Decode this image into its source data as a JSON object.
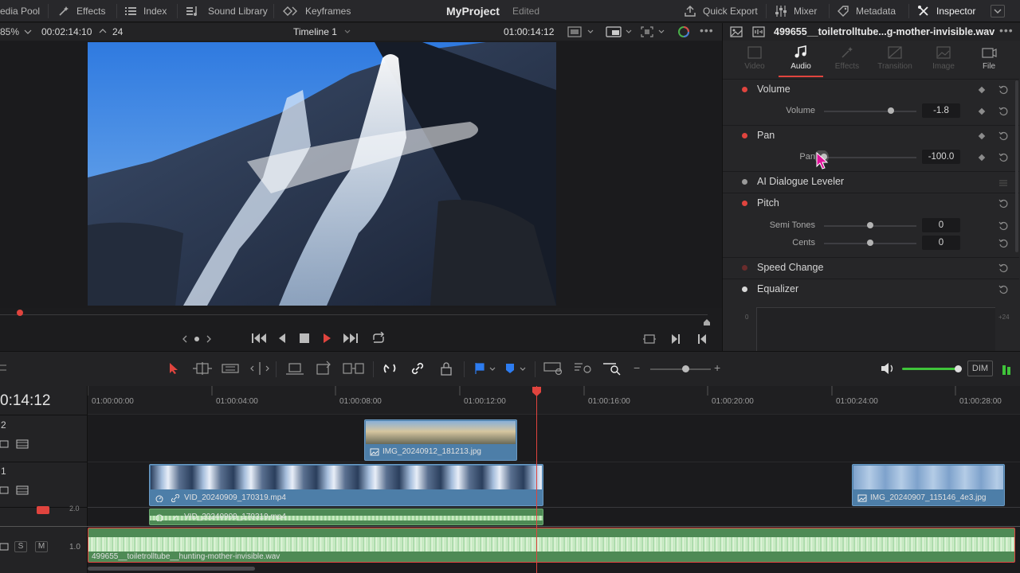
{
  "topbar": {
    "media_pool": "edia Pool",
    "effects": "Effects",
    "index": "Index",
    "sound_library": "Sound Library",
    "keyframes": "Keyframes",
    "project_title": "MyProject",
    "project_status": "Edited",
    "quick_export": "Quick Export",
    "mixer": "Mixer",
    "metadata": "Metadata",
    "inspector": "Inspector"
  },
  "viewer": {
    "zoom": "85%",
    "source_timecode": "00:02:14:10",
    "fps": "24",
    "timeline_name": "Timeline 1",
    "record_timecode": "01:00:14:12"
  },
  "inspector": {
    "clip_name": "499655__toiletrolltube...g-mother-invisible.wav",
    "tabs": [
      "Video",
      "Audio",
      "Effects",
      "Transition",
      "Image",
      "File"
    ],
    "active_tab": "Audio",
    "volume": {
      "title": "Volume",
      "param": "Volume",
      "value": "-1.8",
      "level": 0.72
    },
    "pan": {
      "title": "Pan",
      "param": "Pan",
      "value": "-100.0",
      "level": 0.0
    },
    "dialogue": {
      "title": "AI Dialogue Leveler"
    },
    "pitch": {
      "title": "Pitch",
      "semitones_label": "Semi Tones",
      "semitones": "0",
      "cents_label": "Cents",
      "cents": "0",
      "level": 0.5
    },
    "speed": {
      "title": "Speed Change"
    },
    "equalizer": {
      "title": "Equalizer",
      "y_top": "0",
      "y_right": "+24"
    }
  },
  "timeline": {
    "timecode": "0:14:12",
    "dim_label": "DIM",
    "ruler": [
      "01:00:00:00",
      "01:00:04:00",
      "01:00:08:00",
      "01:00:12:00",
      "01:00:16:00",
      "01:00:20:00",
      "01:00:24:00",
      "01:00:28:00"
    ],
    "tracks": {
      "v2_label": "2",
      "v1_label": "1",
      "a1_level": "2.0",
      "a2_level": "1.0",
      "solo": "S",
      "mute": "M"
    },
    "clips": {
      "img1": "IMG_20240912_181213.jpg",
      "vid": "VID_20240909_170319.mp4",
      "img2": "IMG_20240907_115146_4e3.jpg",
      "vid_audio": "VID_20240909_170319.mp4",
      "wav": "499655__toiletrolltube__hunting-mother-invisible.wav"
    }
  },
  "colors": {
    "accent_red": "#e0443e",
    "video_clip": "#4d7ea8",
    "audio_clip": "#4e8a55",
    "level_green": "#3fc43a"
  }
}
